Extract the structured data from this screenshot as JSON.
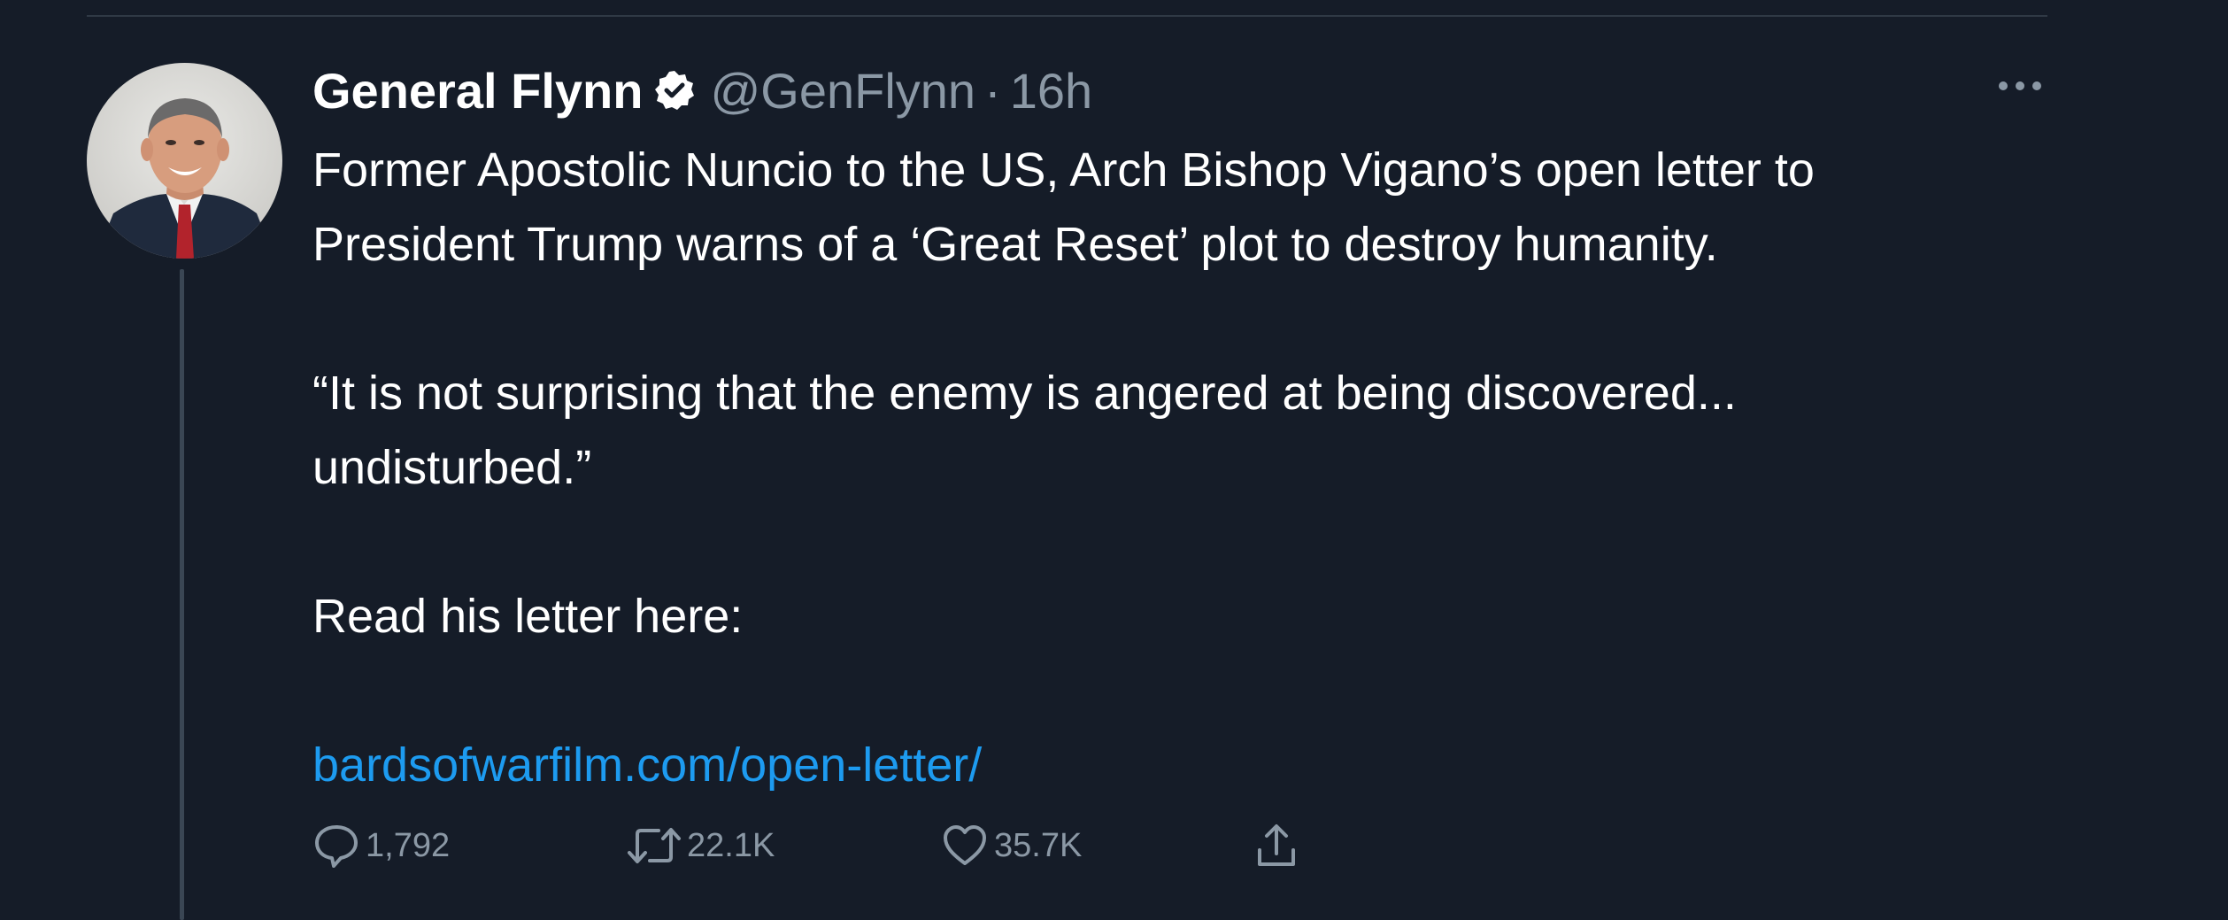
{
  "tweet": {
    "author": {
      "display_name": "General Flynn",
      "handle": "@GenFlynn",
      "verified": true,
      "avatar_icon": "profile-photo"
    },
    "separator": "·",
    "time": "16h",
    "body": {
      "line1": "Former Apostolic Nuncio to the US, Arch Bishop Vigano’s open letter to",
      "line2": "President Trump warns of a ‘Great Reset’ plot to destroy humanity.",
      "line3": "“It is not surprising that the enemy is angered at being discovered...",
      "line4": "undisturbed.”",
      "line5": "Read his letter here:",
      "link": "bardsofwarfilm.com/open-letter/"
    },
    "actions": {
      "replies": "1,792",
      "retweets": "22.1K",
      "likes": "35.7K"
    }
  },
  "colors": {
    "background": "#151c28",
    "text": "#ffffff",
    "secondary_text": "#8b98a5",
    "link": "#1d9bf0",
    "divider": "#2f3945"
  },
  "icons": {
    "more": "more-horizontal-icon",
    "reply": "reply-bubble-icon",
    "retweet": "retweet-icon",
    "like": "heart-icon",
    "share": "share-upload-icon",
    "verified": "verified-badge-icon"
  }
}
